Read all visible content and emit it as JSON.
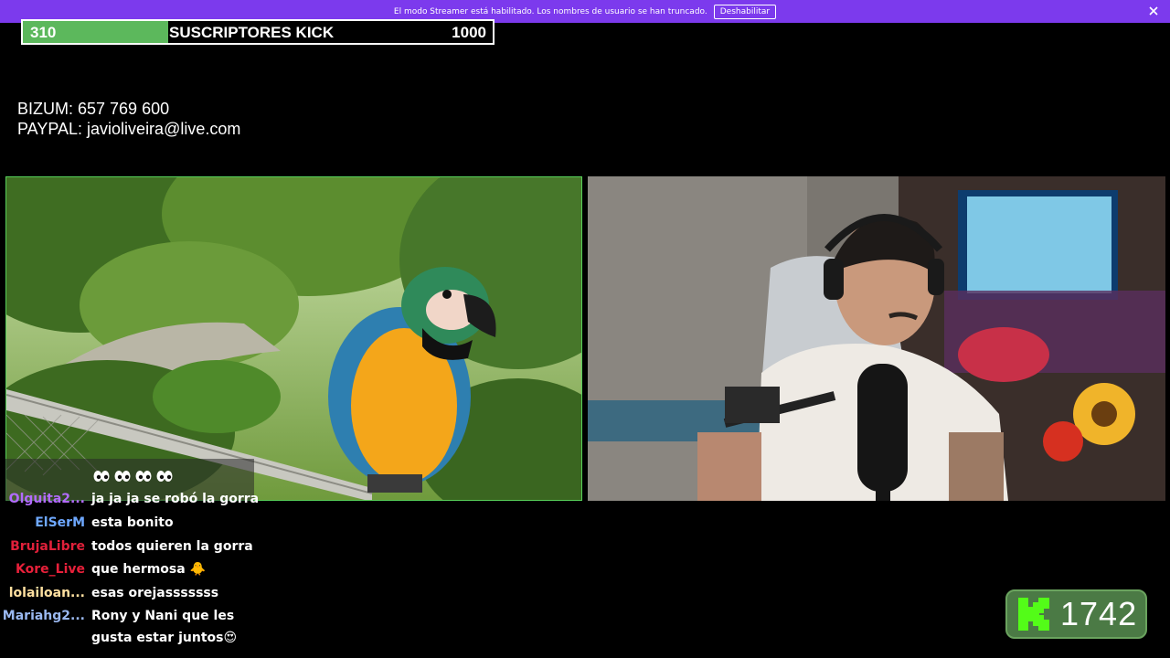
{
  "banner": {
    "message": "El modo Streamer está habilitado. Los nombres de usuario se han truncado.",
    "disable_label": "Deshabilitar",
    "color": "#7c3aed"
  },
  "goal": {
    "current": "310",
    "label": "SUSCRIPTORES KICK",
    "target": "1000",
    "progress_fraction": 0.31,
    "fill_color": "#5cb85c"
  },
  "donations": {
    "bizum": "BIZUM: 657 769 600",
    "paypal": "PAYPAL: javioliveira@live.com"
  },
  "panels": {
    "left": {
      "icon": "parrot-video-feed",
      "border_color": "#57d05a"
    },
    "right": {
      "icon": "webcam-video-feed"
    }
  },
  "chat": {
    "emotes": [
      "eyes-emote",
      "eyes-emote",
      "eyes-emote",
      "eyes-emote"
    ],
    "messages": [
      {
        "user": "Olguita2...",
        "text": "ja ja ja se robó la gorra",
        "color": "#b36bff"
      },
      {
        "user": "ElSerM",
        "text": "esta bonito",
        "color": "#6ea8ff"
      },
      {
        "user": "BrujaLibre",
        "text": "todos quieren la gorra",
        "color": "#e0203a"
      },
      {
        "user": "Kore_Live",
        "text": "que hermosa 🐥",
        "color": "#e8203a"
      },
      {
        "user": "lolailoan...",
        "text": "esas orejasssssss",
        "color": "#ffe0a0"
      },
      {
        "user": "Mariahg2...",
        "text": "Rony y Nani que les",
        "continuation": "gusta estar juntos😍",
        "color": "#9ab8f0"
      }
    ]
  },
  "viewers": {
    "count": "1742",
    "icon": "kick-logo-icon",
    "color": "#53fc18"
  }
}
